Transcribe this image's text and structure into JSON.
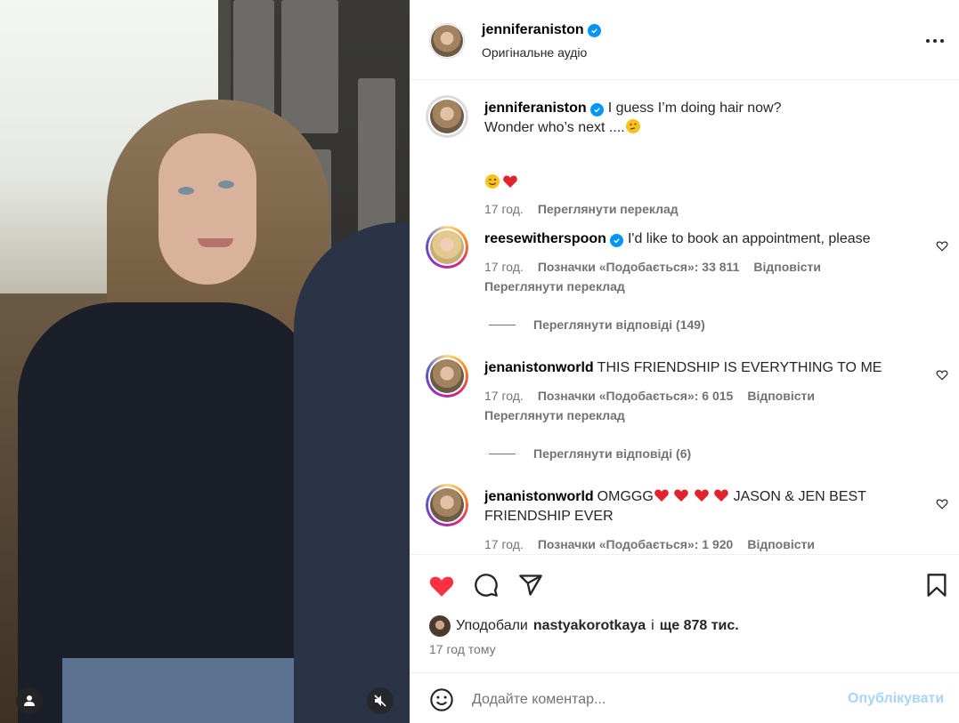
{
  "colors": {
    "accent": "#0095f6",
    "like_red": "#ff3040",
    "muted": "#737373",
    "publish_disabled": "#a8d4f8"
  },
  "media": {
    "user_icon": "person-icon",
    "mute_icon": "speaker-muted-icon"
  },
  "header": {
    "username": "jenniferaniston",
    "subtitle": "Оригінальне аудіо",
    "more_icon": "more-horizontal-icon"
  },
  "caption": {
    "username": "jenniferaniston",
    "line1": "I guess I’m doing hair now?",
    "line2": "Wonder who’s next ....",
    "time": "17 год.",
    "translate": "Переглянути переклад"
  },
  "comments": [
    {
      "username": "reesewitherspoon",
      "verified": true,
      "text": "I'd like to book an appointment, please",
      "time": "17 год.",
      "likes": "Позначки «Подобається»: 33 811",
      "reply": "Відповісти",
      "translate": "Переглянути переклад",
      "replies": "Переглянути відповіді (149)"
    },
    {
      "username": "jenanistonworld",
      "verified": false,
      "text": "THIS FRIENDSHIP IS EVERYTHING TO ME",
      "time": "17 год.",
      "likes": "Позначки «Подобається»: 6 015",
      "reply": "Відповісти",
      "translate": "Переглянути переклад",
      "replies": "Переглянути відповіді (6)"
    },
    {
      "username": "jenanistonworld",
      "verified": false,
      "text_start": "OMGGG",
      "text_end": " JASON & JEN BEST FRIENDSHIP EVER",
      "time": "17 год.",
      "likes": "Позначки «Подобається»: 1 920",
      "reply": "Відповісти"
    }
  ],
  "actions": {
    "like_icon": "heart-filled-icon",
    "comment_icon": "comment-icon",
    "share_icon": "send-icon",
    "save_icon": "bookmark-icon",
    "liked_by_prefix": "Уподобали",
    "liked_by_user": "nastyakorotkaya",
    "liked_by_mid": "і",
    "liked_by_count": "ще 878 тис.",
    "time_ago": "17 год тому"
  },
  "add_comment": {
    "placeholder": "Додайте коментар...",
    "publish": "Опублікувати",
    "emoji_icon": "smiley-icon"
  }
}
